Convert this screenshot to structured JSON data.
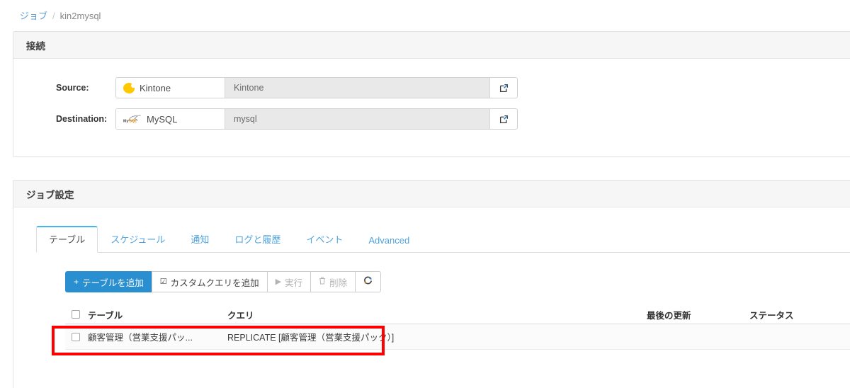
{
  "breadcrumb": {
    "root_label": "ジョブ",
    "separator": "/",
    "current_label": "kin2mysql"
  },
  "connection_panel": {
    "title": "接続",
    "rows": [
      {
        "label": "Source:",
        "type_name": "Kintone",
        "type_icon": "kintone-logo-icon",
        "value": "Kintone",
        "open_icon": "external-link-icon"
      },
      {
        "label": "Destination:",
        "type_name": "MySQL",
        "type_icon": "mysql-dolphin-icon",
        "value": "mysql",
        "open_icon": "external-link-icon"
      }
    ]
  },
  "job_settings_panel": {
    "title": "ジョブ設定",
    "tabs": [
      {
        "label": "テーブル",
        "active": true
      },
      {
        "label": "スケジュール",
        "active": false
      },
      {
        "label": "通知",
        "active": false
      },
      {
        "label": "ログと履歴",
        "active": false
      },
      {
        "label": "イベント",
        "active": false
      },
      {
        "label": "Advanced",
        "active": false
      }
    ],
    "toolbar": [
      {
        "label": "テーブルを追加",
        "glyph": "+",
        "icon": "plus-icon",
        "style": "primary",
        "disabled": false
      },
      {
        "label": "カスタムクエリを追加",
        "glyph": "☑",
        "icon": "edit-square-icon",
        "style": "default",
        "disabled": false
      },
      {
        "label": "実行",
        "glyph": "▶",
        "icon": "play-icon",
        "style": "default",
        "disabled": true
      },
      {
        "label": "削除",
        "glyph": "🗑",
        "icon": "trash-icon",
        "style": "default",
        "disabled": true
      },
      {
        "label": "",
        "glyph": "⟳",
        "icon": "refresh-icon",
        "style": "default",
        "disabled": false
      }
    ],
    "table": {
      "columns": [
        {
          "key": "checkbox",
          "label": ""
        },
        {
          "key": "table",
          "label": "テーブル"
        },
        {
          "key": "query",
          "label": "クエリ"
        },
        {
          "key": "updated",
          "label": "最後の更新"
        },
        {
          "key": "status",
          "label": "ステータス"
        }
      ],
      "rows": [
        {
          "checked": false,
          "table": "顧客管理（営業支援パッ...",
          "query": "REPLICATE [顧客管理（営業支援パック）]",
          "updated": "",
          "status": ""
        }
      ]
    }
  },
  "annotation": {
    "type": "highlight-rectangle",
    "color": "#ff0000",
    "target": "table-row"
  },
  "colors": {
    "link": "#5b9bd5",
    "tab_link": "#4fa3df",
    "tab_active_accent": "#45b5f0",
    "primary_button": "#2a8fd0",
    "kintone_yellow": "#ffc800",
    "annotation_red": "#ff0000",
    "panel_header_bg": "#f6f6f6",
    "disabled_field_bg": "#e9e9e9"
  }
}
